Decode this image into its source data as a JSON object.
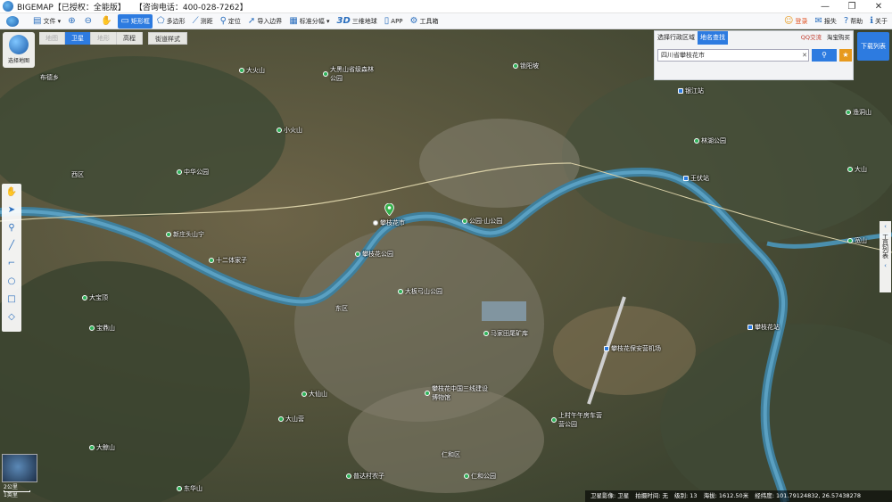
{
  "window": {
    "app_title": "BIGEMAP【已授权：全能版】",
    "phone": "【咨询电话：400-028-7262】",
    "controls": [
      "—",
      "❐",
      "✕"
    ]
  },
  "toolbar": {
    "items": [
      {
        "icon": "folder-icon",
        "glyph": "▤",
        "label": "文件 ▾"
      },
      {
        "icon": "zoom-in-icon",
        "glyph": "⊕",
        "label": ""
      },
      {
        "icon": "zoom-out-icon",
        "glyph": "⊖",
        "label": ""
      },
      {
        "icon": "pan-hand-icon",
        "glyph": "✋",
        "label": ""
      },
      {
        "icon": "rectangle-icon",
        "glyph": "▭",
        "label": "矩形框",
        "active": true
      },
      {
        "icon": "polygon-icon",
        "glyph": "⬠",
        "label": "多边形"
      },
      {
        "icon": "measure-icon",
        "glyph": "⟋",
        "label": "测距"
      },
      {
        "icon": "locate-icon",
        "glyph": "⚲",
        "label": "定位"
      },
      {
        "icon": "import-icon",
        "glyph": "➚",
        "label": "导入边界"
      },
      {
        "icon": "grid-icon",
        "glyph": "▦",
        "label": "标准分幅 ▾"
      },
      {
        "icon": "3d-icon",
        "glyph": "3D",
        "label": "三维地球"
      },
      {
        "icon": "app-icon",
        "glyph": "▯",
        "label": "APP"
      },
      {
        "icon": "toolbox-icon",
        "glyph": "⚙",
        "label": "工具箱"
      }
    ],
    "right_items": [
      {
        "icon": "login-icon",
        "glyph": "☺",
        "label": "登录"
      },
      {
        "icon": "feedback-icon",
        "glyph": "✉",
        "label": "报失"
      },
      {
        "icon": "help-icon",
        "glyph": "?",
        "label": "帮助"
      },
      {
        "icon": "about-icon",
        "glyph": "ℹ",
        "label": "关于"
      }
    ]
  },
  "map_selector": {
    "label": "选择地图"
  },
  "map_types": [
    {
      "label": "地图",
      "state": "dim"
    },
    {
      "label": "卫星",
      "state": "active"
    },
    {
      "label": "地形",
      "state": "dim"
    },
    {
      "label": "高程",
      "state": "normal"
    }
  ],
  "street_style": "街道样式",
  "left_tools": [
    {
      "icon": "hand-icon",
      "glyph": "✋"
    },
    {
      "icon": "arrow-icon",
      "glyph": "➤"
    },
    {
      "icon": "marker-icon",
      "glyph": "⚲"
    },
    {
      "icon": "line-icon",
      "glyph": "╱"
    },
    {
      "icon": "polyline-icon",
      "glyph": "⌐"
    },
    {
      "icon": "circle-icon",
      "glyph": "○"
    },
    {
      "icon": "rect-icon",
      "glyph": "□"
    },
    {
      "icon": "eraser-icon",
      "glyph": "◇"
    }
  ],
  "search": {
    "tab_region": "选择行政区域",
    "tab_place": "地名查找",
    "qq_group": "QQ交流",
    "taobao": "淘宝购买",
    "value": "四川省攀枝花市",
    "clear": "✕",
    "search_glyph": "⚲",
    "star_glyph": "★"
  },
  "download_button": "下载列表",
  "right_tab": {
    "label": "工具列表",
    "arrow_up": "‹",
    "arrow_down": "‹"
  },
  "scale": {
    "line1": "2公里",
    "line2": "1英里"
  },
  "status": {
    "source": "卫星影像: 卫星",
    "capture_time": "拍摄时间: 无",
    "level": "级别: 13",
    "altitude": "海拔: 1612.50米",
    "coords": "经纬度: 101.79124832, 26.57438278"
  },
  "pois": [
    {
      "name": "大火山",
      "style": "green"
    },
    {
      "name": "大黑山省级森林公园",
      "style": "green"
    },
    {
      "name": "锁阳坡",
      "style": "green"
    },
    {
      "name": "布德乡",
      "style": "plain"
    },
    {
      "name": "小火山",
      "style": "green"
    },
    {
      "name": "中华公园",
      "style": "green"
    },
    {
      "name": "西区",
      "style": "plain"
    },
    {
      "name": "攀枝花市",
      "style": "white"
    },
    {
      "name": "公园·山公园",
      "style": "green"
    },
    {
      "name": "攀枝花公园",
      "style": "green"
    },
    {
      "name": "新庄头山宁",
      "style": "green"
    },
    {
      "name": "十二体家子",
      "style": "green"
    },
    {
      "name": "大板弓山公园",
      "style": "green"
    },
    {
      "name": "大宝顶",
      "style": "green"
    },
    {
      "name": "东区",
      "style": "plain"
    },
    {
      "name": "宝鼎山",
      "style": "green"
    },
    {
      "name": "攀枝花中国三线建设博物馆",
      "style": "green"
    },
    {
      "name": "马家田尾矿库",
      "style": "green"
    },
    {
      "name": "攀枝花保安营机场",
      "style": "blue"
    },
    {
      "name": "仁和区",
      "style": "plain"
    },
    {
      "name": "仁和公园",
      "style": "green"
    },
    {
      "name": "大山营",
      "style": "green"
    },
    {
      "name": "上村午午房车营营公园",
      "style": "green"
    },
    {
      "name": "大仙山",
      "style": "green"
    },
    {
      "name": "大鲸山",
      "style": "green"
    },
    {
      "name": "普达村农子",
      "style": "green"
    },
    {
      "name": "东华山",
      "style": "green"
    },
    {
      "name": "林湖公园",
      "style": "green"
    },
    {
      "name": "渔洞山",
      "style": "green"
    },
    {
      "name": "银江站",
      "style": "blue"
    },
    {
      "name": "攀枝花站",
      "style": "blue"
    },
    {
      "name": "王伏站",
      "style": "blue"
    },
    {
      "name": "大山",
      "style": "green"
    },
    {
      "name": "宽山",
      "style": "green"
    }
  ]
}
